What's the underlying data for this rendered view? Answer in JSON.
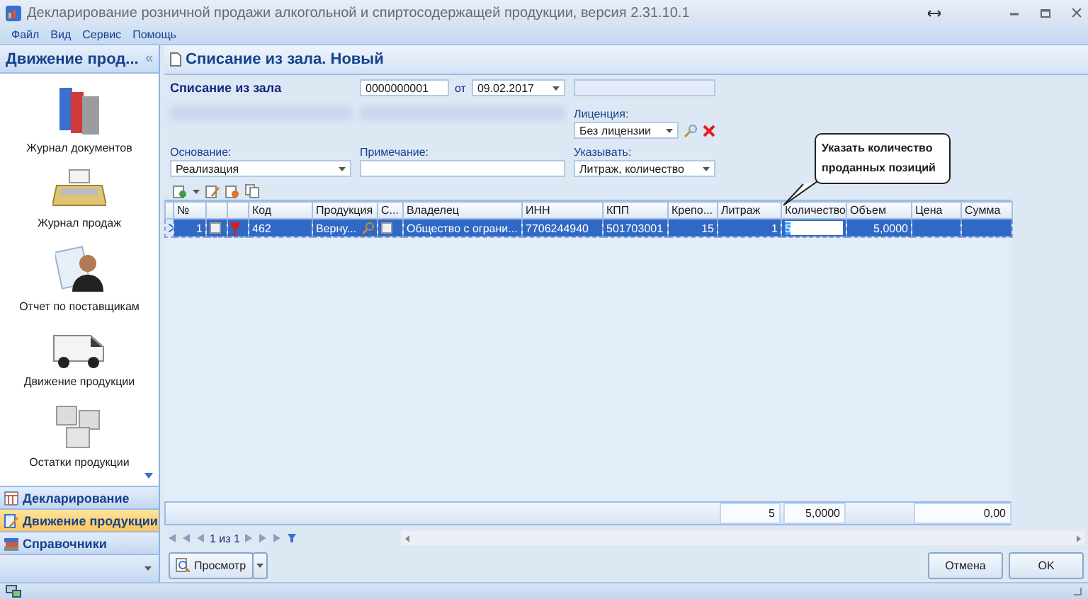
{
  "window": {
    "title": "Декларирование розничной продажи алкогольной и спиртосодержащей продукции, версия 2.31.10.1"
  },
  "menu": [
    "Файл",
    "Вид",
    "Сервис",
    "Помощь"
  ],
  "sidebar": {
    "title": "Движение прод...",
    "collapse": "«",
    "items": [
      {
        "label": "Журнал документов",
        "kind": "books"
      },
      {
        "label": "Журнал продаж",
        "kind": "register"
      },
      {
        "label": "Отчет по поставщикам",
        "kind": "report"
      },
      {
        "label": "Движение продукции",
        "kind": "van"
      },
      {
        "label": "Остатки продукции",
        "kind": "boxes"
      }
    ],
    "nav": [
      {
        "label": "Декларирование",
        "selected": false,
        "kind": "table"
      },
      {
        "label": "Движение продукции",
        "selected": true,
        "kind": "edit"
      },
      {
        "label": "Справочники",
        "selected": false,
        "kind": "books"
      }
    ]
  },
  "document": {
    "title": "Списание из зала. Новый",
    "type_label": "Списание из зала",
    "number": "0000000001",
    "date_prefix": "от",
    "date": "09.02.2017",
    "license": {
      "label": "Лиценция:",
      "value": "Без лицензии"
    },
    "basis": {
      "label": "Основание:",
      "value": "Реализация"
    },
    "note": {
      "label": "Примечание:"
    },
    "show": {
      "label": "Указывать:",
      "value": "Литраж, количество"
    }
  },
  "callout": [
    "Указать количество",
    "проданных позиций"
  ],
  "grid": {
    "columns": [
      {
        "kind": "text",
        "label": "№"
      },
      {
        "kind": "checkbox"
      },
      {
        "kind": "icon"
      },
      {
        "kind": "text",
        "label": "Код"
      },
      {
        "kind": "text",
        "label": "Продукция"
      },
      {
        "kind": "text",
        "label": "С..."
      },
      {
        "kind": "text",
        "label": "Владелец"
      },
      {
        "kind": "text",
        "label": "ИНН"
      },
      {
        "kind": "text",
        "label": "КПП"
      },
      {
        "kind": "text",
        "label": "Крепо..."
      },
      {
        "kind": "text",
        "label": "Литраж"
      },
      {
        "kind": "text",
        "label": "Количество"
      },
      {
        "kind": "text",
        "label": "Объем"
      },
      {
        "kind": "text",
        "label": "Цена"
      },
      {
        "kind": "text",
        "label": "Сумма"
      }
    ],
    "rows": [
      {
        "selected": true,
        "cells": [
          {
            "kind": "number",
            "text": "1"
          },
          {
            "kind": "checkbox",
            "checked": false
          },
          {
            "kind": "icon"
          },
          {
            "kind": "text",
            "text": "462"
          },
          {
            "kind": "lookup",
            "text": "Верну..."
          },
          {
            "kind": "checkbox",
            "checked": false
          },
          {
            "kind": "text",
            "text": "Общество с ограни..."
          },
          {
            "kind": "text",
            "text": "7706244940"
          },
          {
            "kind": "text",
            "text": "501703001"
          },
          {
            "kind": "number",
            "text": "15"
          },
          {
            "kind": "number",
            "text": "1"
          },
          {
            "kind": "edit",
            "text": "5"
          },
          {
            "kind": "number",
            "text": "5,0000"
          },
          {
            "kind": "text"
          },
          {
            "kind": "text"
          }
        ]
      }
    ],
    "totals": {
      "quantity": "5",
      "volume": "5,0000",
      "sum": "0,00"
    }
  },
  "pager": {
    "position": "1 из 1"
  },
  "buttons": {
    "preview": "Просмотр",
    "cancel": "Отмена",
    "ok": "OK"
  }
}
